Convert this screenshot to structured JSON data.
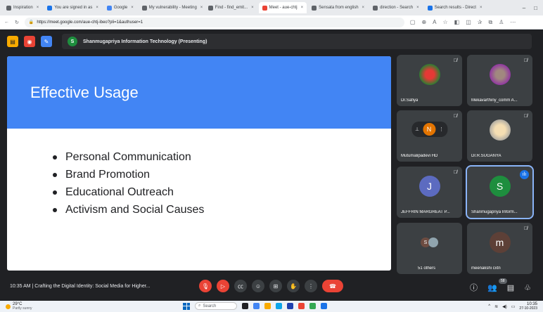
{
  "browser": {
    "tabs": [
      {
        "label": "Inspiration",
        "active": false
      },
      {
        "label": "You are signed in as",
        "active": false
      },
      {
        "label": "Google",
        "active": false
      },
      {
        "label": "My vulnerability - Meeting",
        "active": false
      },
      {
        "label": "Find - find_emit...",
        "active": false
      },
      {
        "label": "Meet - aue-chtj",
        "active": true
      },
      {
        "label": "Sensata from english",
        "active": false
      },
      {
        "label": "direction - Search",
        "active": false
      },
      {
        "label": "Search results - Direct",
        "active": false
      }
    ],
    "url": "https://meet.google.com/aue-chtj-ibeo?pli=1&authuser=1"
  },
  "meet": {
    "presenter_initial": "S",
    "presenting_label": "Shanmugapriya Information Technology (Presenting)",
    "slide": {
      "title": "Effective Usage",
      "bullets": [
        "Personal Communication",
        "Brand Promotion",
        "Educational Outreach",
        "Activism and Social Causes"
      ]
    },
    "participants": [
      {
        "name": "Dr.Safiya",
        "avatar": "flower-photo",
        "muted": true
      },
      {
        "name": "Mekavarthiny_comm A...",
        "avatar": "portrait-photo",
        "muted": true
      },
      {
        "name": "Mutumalipadevi HD",
        "avatar": "user-photo",
        "muted": true
      },
      {
        "name": "Dr.R.SUGANYA",
        "avatar": "child-photo",
        "muted": true
      },
      {
        "name": "JEFFRIN MARGREAT P...",
        "initial": "J",
        "color": "#5c6bc0",
        "muted": true
      },
      {
        "name": "Shanmugapriya Inform...",
        "initial": "S",
        "color": "#1e8e3e",
        "speaking": true
      },
      {
        "name": "51 others",
        "initial": "S",
        "color": "#6d4c41"
      },
      {
        "name": "meenakshi cxtn",
        "initial": "m",
        "color": "#5d4037",
        "muted": true
      }
    ],
    "meeting_time": "10:35 AM",
    "meeting_title": "Crafting the Digital Identity: Social Media for Higher...",
    "participant_count": "58",
    "accent_red": "#ea4335",
    "accent_blue": "#4285f4"
  },
  "taskbar": {
    "weather_temp": "29°C",
    "weather_desc": "Partly sunny",
    "search_placeholder": "Search",
    "time": "10:35",
    "date": "27-10-2023"
  }
}
